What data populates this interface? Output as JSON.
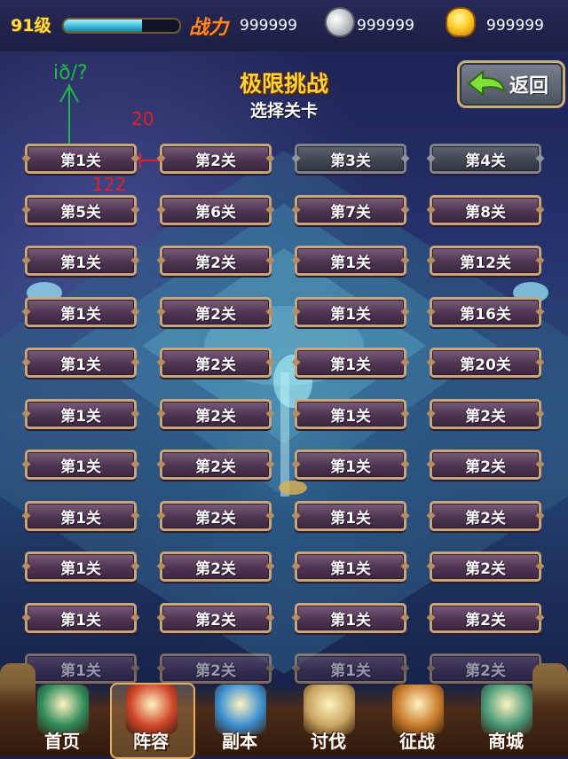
{
  "status": {
    "level": "91级",
    "xp_fraction": 0.68,
    "power_label": "战力",
    "power_value": "999999",
    "silver_value": "999999",
    "gold_value": "999999"
  },
  "header": {
    "title": "极限挑战",
    "subtitle": "选择关卡",
    "back_label": "返回"
  },
  "annotations": {
    "green_note": "ið/?",
    "red_top": "20",
    "red_side": "122"
  },
  "stages": [
    {
      "label": "第1关",
      "state": "normal"
    },
    {
      "label": "第2关",
      "state": "normal"
    },
    {
      "label": "第3关",
      "state": "locked"
    },
    {
      "label": "第4关",
      "state": "locked"
    },
    {
      "label": "第5关",
      "state": "normal"
    },
    {
      "label": "第6关",
      "state": "normal"
    },
    {
      "label": "第7关",
      "state": "normal"
    },
    {
      "label": "第8关",
      "state": "normal"
    },
    {
      "label": "第1关",
      "state": "normal"
    },
    {
      "label": "第2关",
      "state": "normal"
    },
    {
      "label": "第1关",
      "state": "normal"
    },
    {
      "label": "第12关",
      "state": "normal"
    },
    {
      "label": "第1关",
      "state": "normal"
    },
    {
      "label": "第2关",
      "state": "normal"
    },
    {
      "label": "第1关",
      "state": "normal"
    },
    {
      "label": "第16关",
      "state": "normal"
    },
    {
      "label": "第1关",
      "state": "normal"
    },
    {
      "label": "第2关",
      "state": "normal"
    },
    {
      "label": "第1关",
      "state": "normal"
    },
    {
      "label": "第20关",
      "state": "normal"
    },
    {
      "label": "第1关",
      "state": "normal"
    },
    {
      "label": "第2关",
      "state": "normal"
    },
    {
      "label": "第1关",
      "state": "normal"
    },
    {
      "label": "第2关",
      "state": "normal"
    },
    {
      "label": "第1关",
      "state": "normal"
    },
    {
      "label": "第2关",
      "state": "normal"
    },
    {
      "label": "第1关",
      "state": "normal"
    },
    {
      "label": "第2关",
      "state": "normal"
    },
    {
      "label": "第1关",
      "state": "normal"
    },
    {
      "label": "第2关",
      "state": "normal"
    },
    {
      "label": "第1关",
      "state": "normal"
    },
    {
      "label": "第2关",
      "state": "normal"
    },
    {
      "label": "第1关",
      "state": "normal"
    },
    {
      "label": "第2关",
      "state": "normal"
    },
    {
      "label": "第1关",
      "state": "normal"
    },
    {
      "label": "第2关",
      "state": "normal"
    },
    {
      "label": "第1关",
      "state": "normal"
    },
    {
      "label": "第2关",
      "state": "normal"
    },
    {
      "label": "第1关",
      "state": "normal"
    },
    {
      "label": "第2关",
      "state": "normal"
    },
    {
      "label": "第1关",
      "state": "faded"
    },
    {
      "label": "第2关",
      "state": "faded"
    },
    {
      "label": "第1关",
      "state": "faded"
    },
    {
      "label": "第2关",
      "state": "faded"
    }
  ],
  "nav": [
    {
      "label": "首页",
      "icon": "home-pavilion-icon",
      "active": false
    },
    {
      "label": "阵容",
      "icon": "lineup-banner-icon",
      "active": true
    },
    {
      "label": "副本",
      "icon": "dungeon-portal-icon",
      "active": false
    },
    {
      "label": "讨伐",
      "icon": "crusade-scroll-icon",
      "active": false
    },
    {
      "label": "征战",
      "icon": "campaign-sword-icon",
      "active": false
    },
    {
      "label": "商城",
      "icon": "shop-gate-icon",
      "active": false
    }
  ],
  "colors": {
    "title_gold": "#ffd23c",
    "stage_frame": "#caa77a",
    "stage_fill": "#4e3452",
    "locked_fill": "#3f454f",
    "power_orange": "#ff8a2a"
  }
}
